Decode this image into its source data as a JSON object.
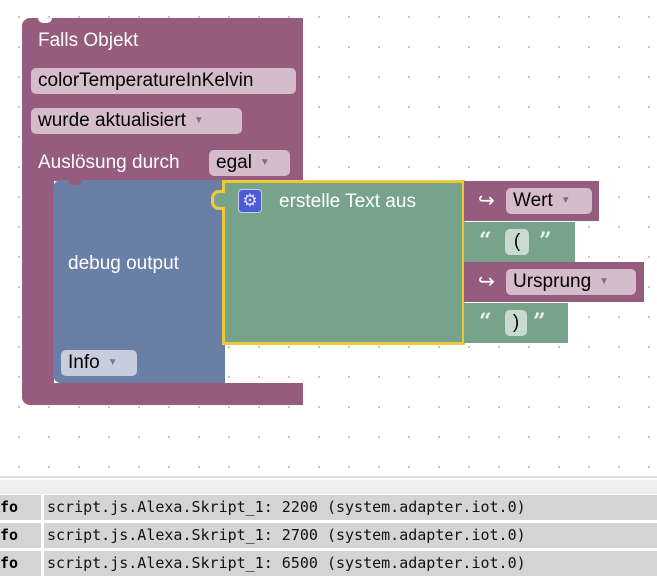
{
  "trigger_block": {
    "title": "Falls Objekt",
    "object_id": "colorTemperatureInKelvin",
    "condition": "wurde aktualisiert",
    "trigger_label": "Auslösung durch",
    "trigger_value": "egal"
  },
  "debug_block": {
    "label": "debug output",
    "level": "Info"
  },
  "text_block": {
    "label": "erstelle Text aus",
    "gear_icon": "gear-icon",
    "inputs": [
      {
        "type": "variable",
        "value": "Wert"
      },
      {
        "type": "text",
        "value": "("
      },
      {
        "type": "variable",
        "value": "Ursprung"
      },
      {
        "type": "text",
        "value": ")"
      }
    ]
  },
  "colors": {
    "event_block": "#955c7d",
    "debug_block": "#6a7fa6",
    "text_block": "#77a38a",
    "selected_outline": "#f0c93a"
  },
  "log": {
    "rows": [
      {
        "level": "fo",
        "message": "script.js.Alexa.Skript_1: 2200 (system.adapter.iot.0)"
      },
      {
        "level": "fo",
        "message": "script.js.Alexa.Skript_1: 2700 (system.adapter.iot.0)"
      },
      {
        "level": "fo",
        "message": "script.js.Alexa.Skript_1: 6500 (system.adapter.iot.0)"
      }
    ]
  }
}
